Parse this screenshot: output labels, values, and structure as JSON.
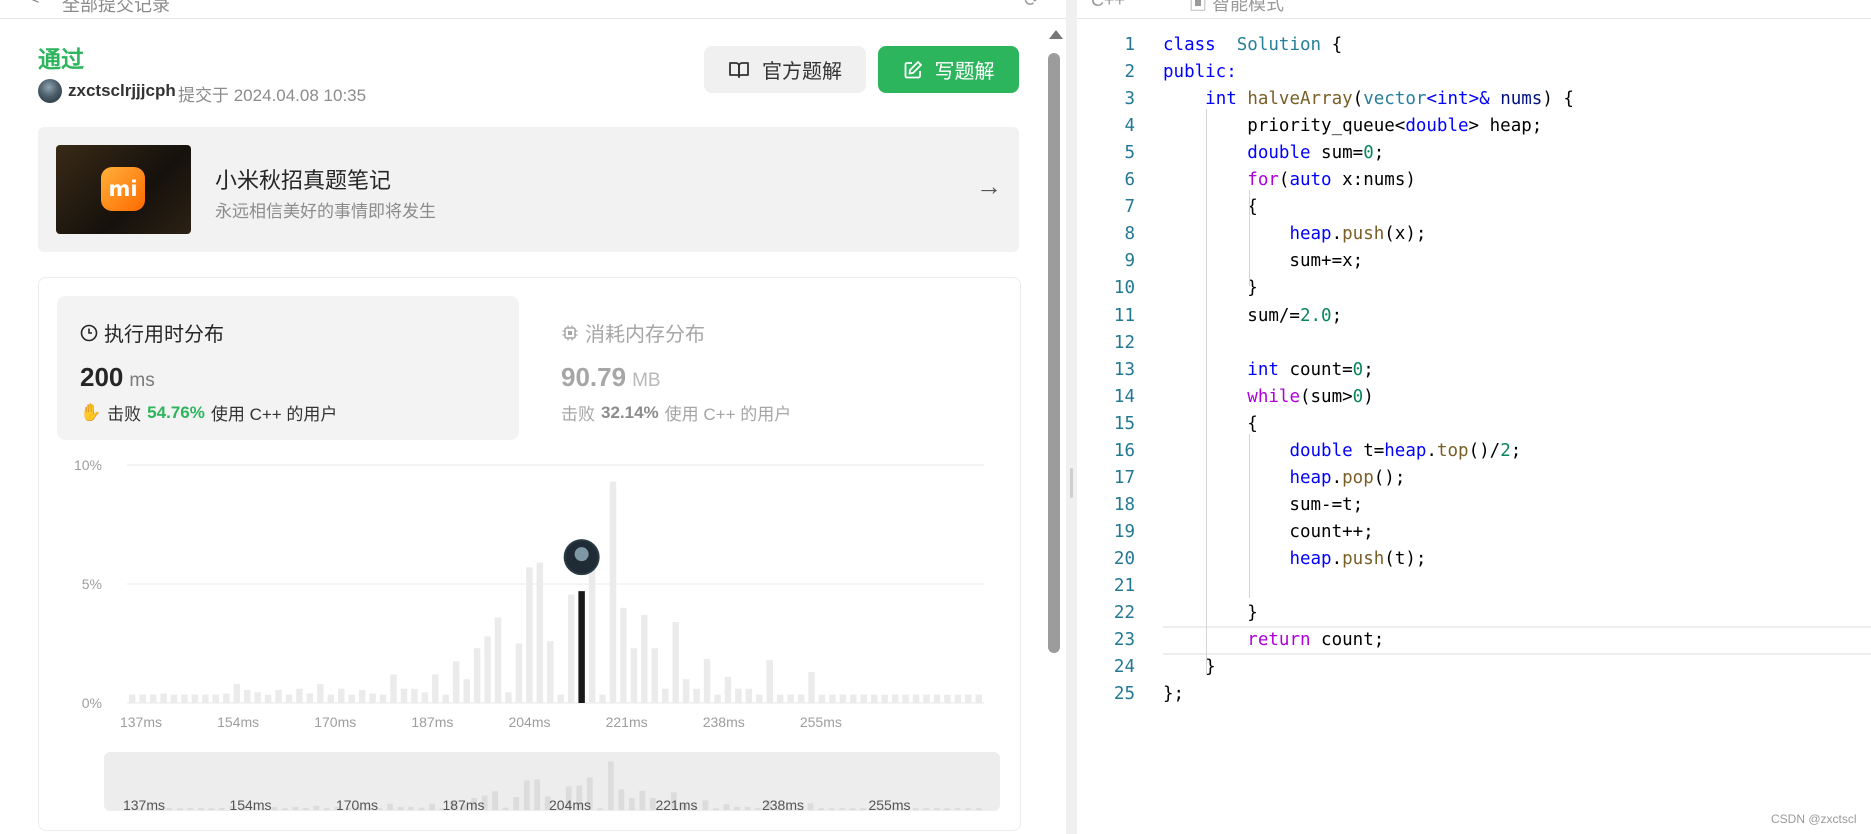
{
  "header": {
    "back_label": "<",
    "breadcrumb": "全部提交记录"
  },
  "submission": {
    "status": "通过",
    "username": "zxctsclrjjjcph",
    "submitted_text": "提交于 2024.04.08 10:35"
  },
  "actions": {
    "official_label": "官方题解",
    "write_label": "写题解"
  },
  "banner": {
    "title": "小米秋招真题笔记",
    "subtitle": "永远相信美好的事情即将发生",
    "logo_text": "mi"
  },
  "stats": {
    "runtime": {
      "title": "执行用时分布",
      "value": "200",
      "unit": "ms",
      "beat_prefix": "击败",
      "beat_pct": "54.76%",
      "beat_suffix": "使用 C++ 的用户"
    },
    "memory": {
      "title": "消耗内存分布",
      "value": "90.79",
      "unit": "MB",
      "beat_prefix": "击败",
      "beat_pct": "32.14%",
      "beat_suffix": "使用 C++ 的用户"
    }
  },
  "chart_data": {
    "type": "bar",
    "title": "",
    "xlabel": "",
    "ylabel": "",
    "ylim": [
      0,
      10
    ],
    "y_ticks": [
      "10%",
      "5%",
      "0%"
    ],
    "x_ticks": [
      "137ms",
      "154ms",
      "170ms",
      "187ms",
      "204ms",
      "221ms",
      "238ms",
      "255ms"
    ],
    "highlight_index": 43,
    "values": [
      0.35,
      0.35,
      0.35,
      0.4,
      0.35,
      0.35,
      0.35,
      0.35,
      0.35,
      0.4,
      0.8,
      0.55,
      0.45,
      0.35,
      0.55,
      0.35,
      0.6,
      0.4,
      0.8,
      0.35,
      0.6,
      0.35,
      0.55,
      0.4,
      0.35,
      1.2,
      0.6,
      0.6,
      0.45,
      1.2,
      0.35,
      1.75,
      1.0,
      2.3,
      2.8,
      3.6,
      0.45,
      2.5,
      5.7,
      5.9,
      2.6,
      0.35,
      4.55,
      4.7,
      6.3,
      0.35,
      9.3,
      4.0,
      2.3,
      3.7,
      2.3,
      0.6,
      3.4,
      1.0,
      0.6,
      1.85,
      0.35,
      1.1,
      0.6,
      0.6,
      0.35,
      1.8,
      0.35,
      0.35,
      0.35,
      1.3,
      0.35,
      0.35,
      0.35,
      0.35,
      0.35,
      0.35,
      0.35,
      0.35,
      0.35,
      0.35,
      0.35,
      0.35,
      0.35,
      0.35,
      0.35,
      0.35
    ]
  },
  "editor": {
    "language_tab": "C++",
    "mode_tab": "智能模式",
    "lines": [
      [
        [
          "k-blue",
          "class"
        ],
        [
          "",
          "  "
        ],
        [
          "k-type",
          "Solution"
        ],
        [
          "",
          " {"
        ]
      ],
      [
        [
          "k-blue",
          "public:"
        ]
      ],
      [
        [
          "",
          "    "
        ],
        [
          "k-blue",
          "int"
        ],
        [
          "",
          " "
        ],
        [
          "k-fn",
          "halveArray"
        ],
        [
          "",
          "("
        ],
        [
          "k-type",
          "vector"
        ],
        [
          "k-blue",
          "<int>&"
        ],
        [
          "",
          " "
        ],
        [
          "k-var",
          "nums"
        ],
        [
          "",
          ") {"
        ]
      ],
      [
        [
          "",
          "        priority_queue<"
        ],
        [
          "k-blue",
          "double"
        ],
        [
          "",
          "> heap;"
        ]
      ],
      [
        [
          "",
          "        "
        ],
        [
          "k-blue",
          "double"
        ],
        [
          "",
          " sum="
        ],
        [
          "k-num",
          "0"
        ],
        [
          "",
          ";"
        ]
      ],
      [
        [
          "",
          "        "
        ],
        [
          "k-pur",
          "for"
        ],
        [
          "",
          "("
        ],
        [
          "k-blue",
          "auto"
        ],
        [
          "",
          " x:nums)"
        ]
      ],
      [
        [
          "",
          "        {"
        ]
      ],
      [
        [
          "",
          "            "
        ],
        [
          "k-blue",
          "heap"
        ],
        [
          "",
          "."
        ],
        [
          "k-fn",
          "push"
        ],
        [
          "",
          "(x);"
        ]
      ],
      [
        [
          "",
          "            sum+=x;"
        ]
      ],
      [
        [
          "",
          "        }"
        ]
      ],
      [
        [
          "",
          "        sum/="
        ],
        [
          "k-num",
          "2.0"
        ],
        [
          "",
          ";"
        ]
      ],
      [
        [
          "",
          ""
        ]
      ],
      [
        [
          "",
          "        "
        ],
        [
          "k-blue",
          "int"
        ],
        [
          "",
          " count="
        ],
        [
          "k-num",
          "0"
        ],
        [
          "",
          ";"
        ]
      ],
      [
        [
          "",
          "        "
        ],
        [
          "k-pur",
          "while"
        ],
        [
          "",
          "(sum>"
        ],
        [
          "k-num",
          "0"
        ],
        [
          "",
          ")"
        ]
      ],
      [
        [
          "",
          "        {"
        ]
      ],
      [
        [
          "",
          "            "
        ],
        [
          "k-blue",
          "double"
        ],
        [
          "",
          " t="
        ],
        [
          "k-blue",
          "heap"
        ],
        [
          "",
          "."
        ],
        [
          "k-fn",
          "top"
        ],
        [
          "",
          "()/"
        ],
        [
          "k-num",
          "2"
        ],
        [
          "",
          ";"
        ]
      ],
      [
        [
          "",
          "            "
        ],
        [
          "k-blue",
          "heap"
        ],
        [
          "",
          "."
        ],
        [
          "k-fn",
          "pop"
        ],
        [
          "",
          "();"
        ]
      ],
      [
        [
          "",
          "            sum-=t;"
        ]
      ],
      [
        [
          "",
          "            count++;"
        ]
      ],
      [
        [
          "",
          "            "
        ],
        [
          "k-blue",
          "heap"
        ],
        [
          "",
          "."
        ],
        [
          "k-fn",
          "push"
        ],
        [
          "",
          "(t);"
        ]
      ],
      [
        [
          "",
          ""
        ]
      ],
      [
        [
          "",
          "        }"
        ]
      ],
      [
        [
          "",
          "        "
        ],
        [
          "k-pur",
          "return"
        ],
        [
          "",
          " count;"
        ]
      ],
      [
        [
          "",
          "    }"
        ]
      ],
      [
        [
          "",
          "};"
        ]
      ]
    ]
  },
  "watermark": "CSDN @zxctscl"
}
